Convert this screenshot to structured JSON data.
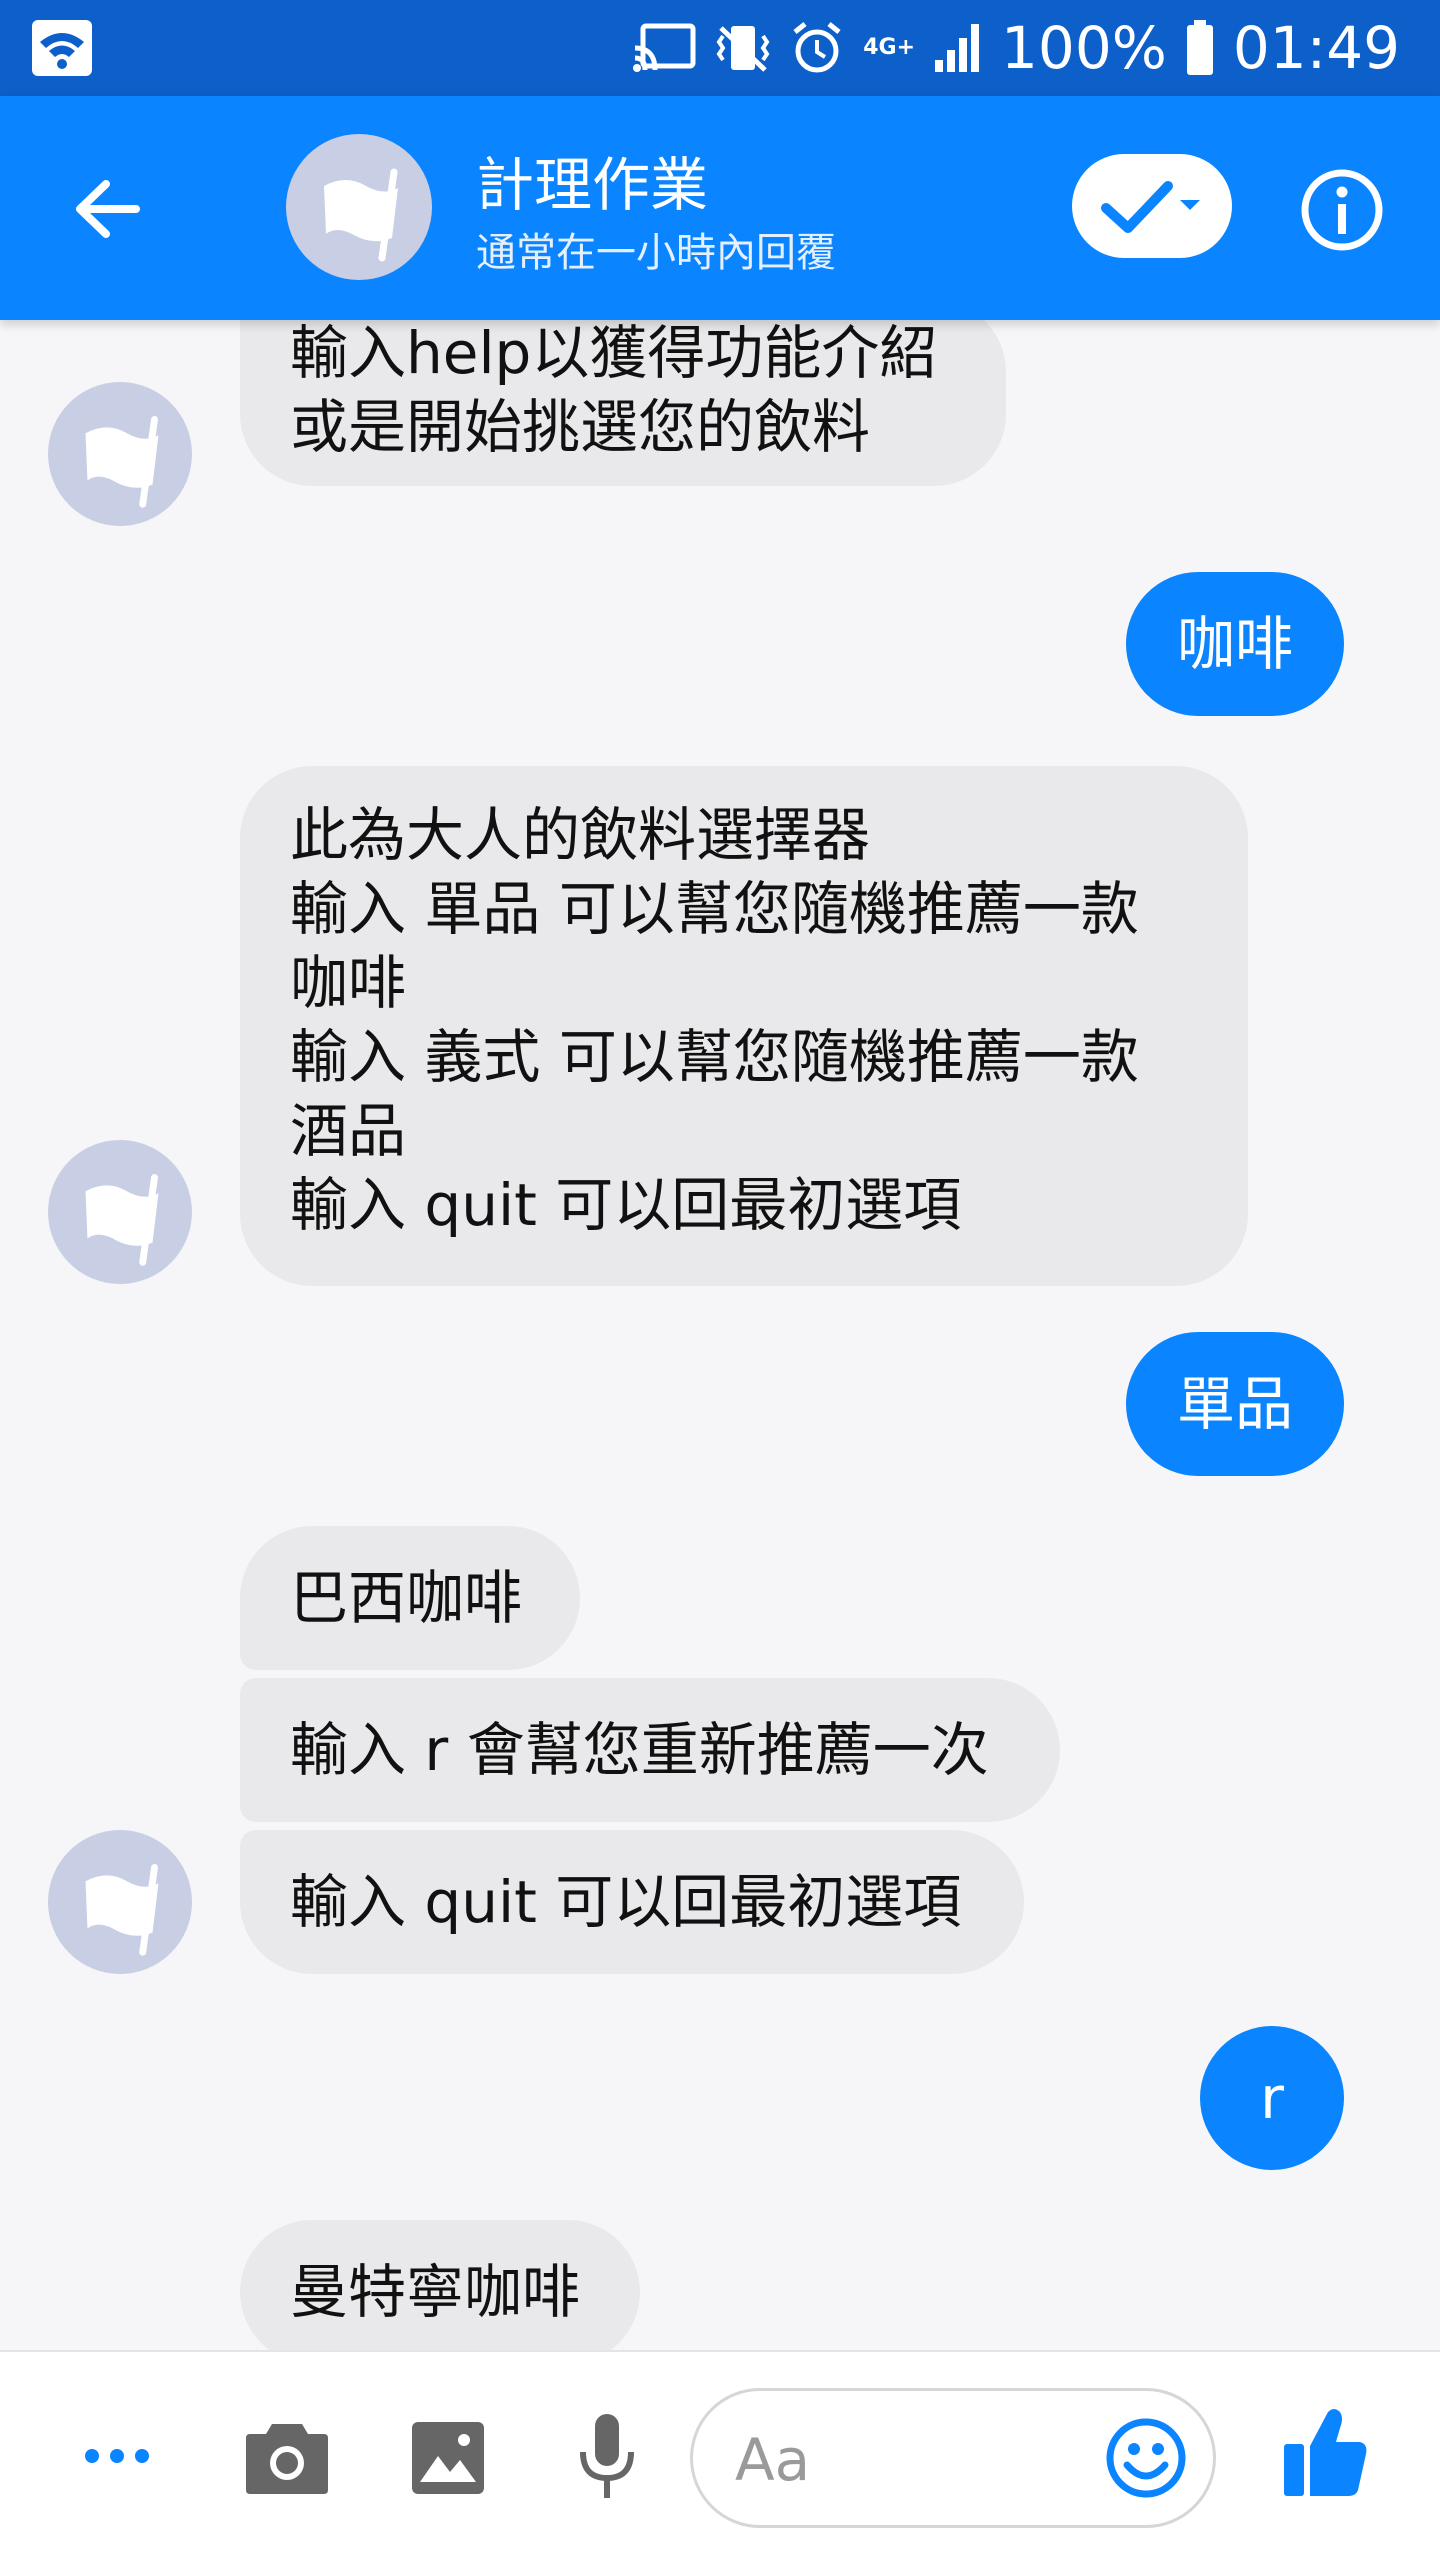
{
  "status_bar": {
    "network": "4G+",
    "battery": "100%",
    "time": "01:49"
  },
  "header": {
    "title": "計理作業",
    "subtitle": "通常在一小時內回覆"
  },
  "messages": [
    {
      "side": "in",
      "lines": [
        "輸入help以獲得功能介紹",
        "或是開始挑選您的飲料"
      ]
    },
    {
      "side": "out",
      "lines": [
        "咖啡"
      ]
    },
    {
      "side": "in",
      "lines": [
        "此為大人的飲料選擇器",
        "輸入 單品 可以幫您隨機推薦一款",
        "咖啡",
        "輸入 義式 可以幫您隨機推薦一款",
        "酒品",
        "輸入 quit 可以回最初選項"
      ]
    },
    {
      "side": "out",
      "lines": [
        "單品"
      ]
    },
    {
      "side": "in",
      "lines": [
        "巴西咖啡"
      ]
    },
    {
      "side": "in",
      "lines": [
        "輸入 r 會幫您重新推薦一次"
      ]
    },
    {
      "side": "in",
      "lines": [
        "輸入 quit 可以回最初選項"
      ]
    },
    {
      "side": "out",
      "lines": [
        "r"
      ]
    },
    {
      "side": "in",
      "lines": [
        "曼特寧咖啡"
      ]
    }
  ],
  "composer": {
    "placeholder": "Aa"
  },
  "colors": {
    "status_bar": "#0d5fc9",
    "accent": "#0a84ff",
    "incoming_bubble": "#e9e9eb",
    "avatar_bg": "#c8cee4"
  },
  "icons": {
    "status_bar": [
      "wifi-icon",
      "cast-icon",
      "vibrate-icon",
      "alarm-icon",
      "signal-icon",
      "battery-icon"
    ],
    "header": [
      "back-arrow-icon",
      "flag-icon",
      "checkmark-icon",
      "info-icon"
    ],
    "bottom_bar": [
      "more-icon",
      "camera-icon",
      "image-icon",
      "microphone-icon",
      "emoji-icon",
      "thumbs-up-icon"
    ]
  }
}
